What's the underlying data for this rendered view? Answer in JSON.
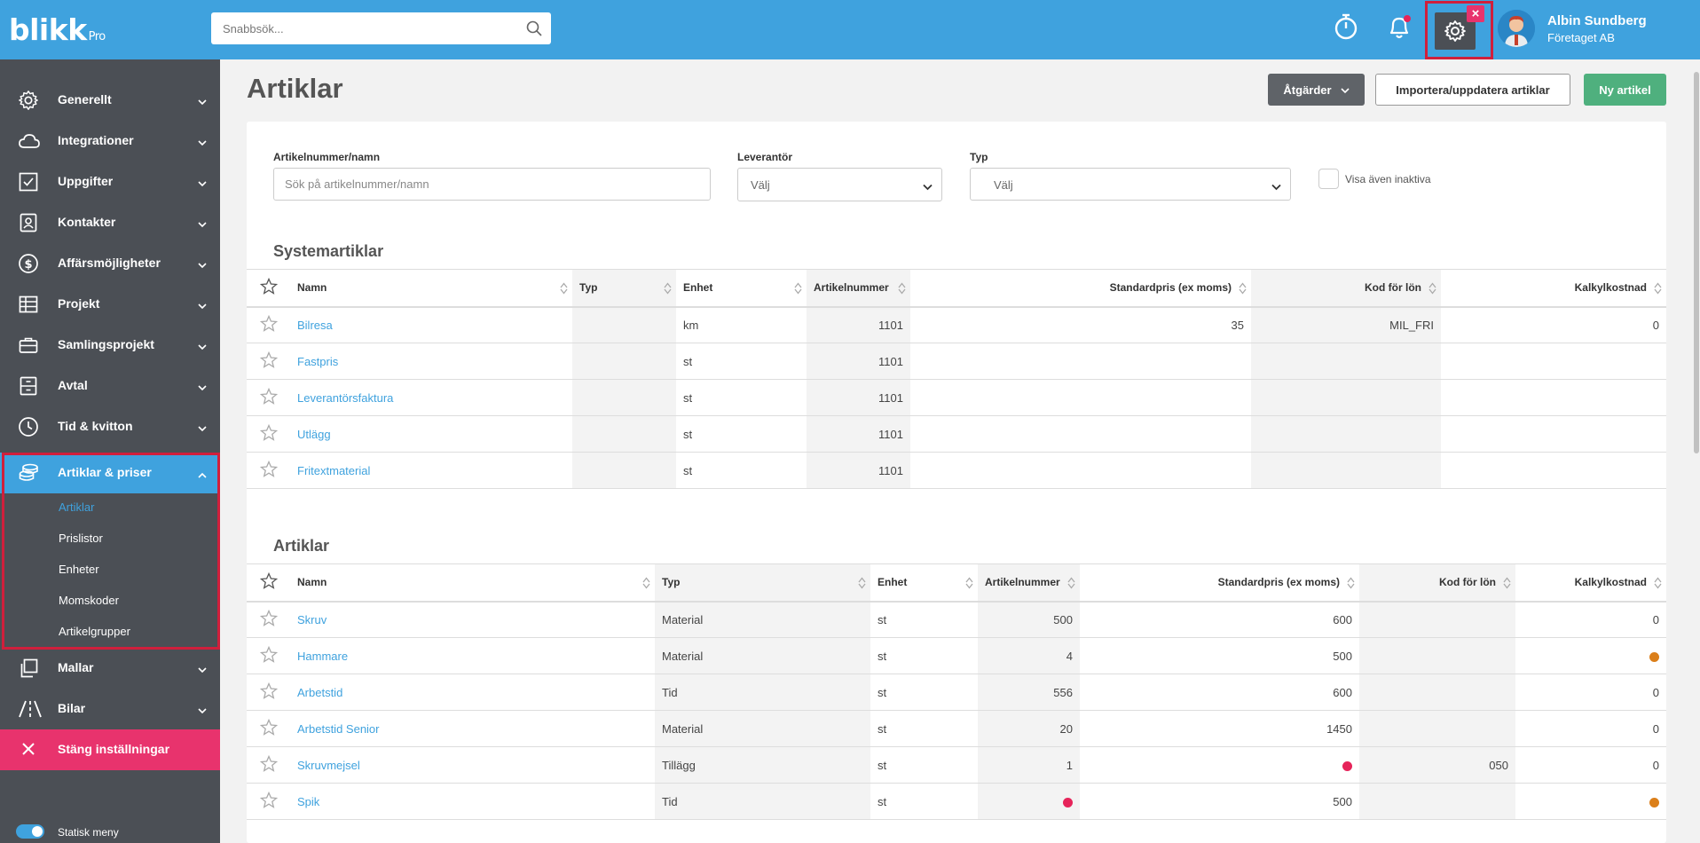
{
  "header": {
    "logo_text": "blikk",
    "logo_suffix": "Pro",
    "search_placeholder": "Snabbsök...",
    "user_name": "Albin Sundberg",
    "user_company": "Företaget AB",
    "notification_dot_color": "#e6245a",
    "icons": [
      "timer-icon",
      "bell-icon",
      "gear-icon",
      "close-icon",
      "search-icon"
    ]
  },
  "sidebar": {
    "items": [
      {
        "label": "Generellt",
        "icon": "gear-icon"
      },
      {
        "label": "Integrationer",
        "icon": "cloud-icon"
      },
      {
        "label": "Uppgifter",
        "icon": "checkbox-icon"
      },
      {
        "label": "Kontakter",
        "icon": "contact-icon"
      },
      {
        "label": "Affärsmöjligheter",
        "icon": "dollar-icon"
      },
      {
        "label": "Projekt",
        "icon": "table-icon"
      },
      {
        "label": "Samlingsprojekt",
        "icon": "briefcase-icon"
      },
      {
        "label": "Avtal",
        "icon": "cabinet-icon"
      },
      {
        "label": "Tid & kvitton",
        "icon": "clock-icon"
      },
      {
        "label": "Artiklar & priser",
        "icon": "coins-icon"
      },
      {
        "label": "Mallar",
        "icon": "copy-icon"
      },
      {
        "label": "Bilar",
        "icon": "road-icon"
      }
    ],
    "subitems": [
      "Artiklar",
      "Prislistor",
      "Enheter",
      "Momskoder",
      "Artikelgrupper"
    ],
    "close_label": "Stäng inställningar",
    "toggle_label": "Statisk meny"
  },
  "main": {
    "title": "Artiklar",
    "buttons": {
      "actions": "Åtgärder",
      "import": "Importera/uppdatera artiklar",
      "new": "Ny artikel"
    },
    "filters": {
      "article_label": "Artikelnummer/namn",
      "article_placeholder": "Sök på artikelnummer/namn",
      "supplier_label": "Leverantör",
      "supplier_value": "Välj",
      "type_label": "Typ",
      "type_value": "Välj",
      "inactive_label": "Visa även inaktiva"
    },
    "system_articles": {
      "title": "Systemartiklar",
      "columns": [
        "Namn",
        "Typ",
        "Enhet",
        "Artikelnummer",
        "Standardpris (ex moms)",
        "Kod för lön",
        "Kalkylkostnad"
      ],
      "rows": [
        {
          "name": "Bilresa",
          "type": "",
          "unit": "km",
          "number": "1101",
          "price": "35",
          "code": "MIL_FRI",
          "cost": "0"
        },
        {
          "name": "Fastpris",
          "type": "",
          "unit": "st",
          "number": "1101",
          "price": "",
          "code": "",
          "cost": ""
        },
        {
          "name": "Leverantörsfaktura",
          "type": "",
          "unit": "st",
          "number": "1101",
          "price": "",
          "code": "",
          "cost": ""
        },
        {
          "name": "Utlägg",
          "type": "",
          "unit": "st",
          "number": "1101",
          "price": "",
          "code": "",
          "cost": ""
        },
        {
          "name": "Fritextmaterial",
          "type": "",
          "unit": "st",
          "number": "1101",
          "price": "",
          "code": "",
          "cost": ""
        }
      ]
    },
    "articles": {
      "title": "Artiklar",
      "columns": [
        "Namn",
        "Typ",
        "Enhet",
        "Artikelnummer",
        "Standardpris (ex moms)",
        "Kod för lön",
        "Kalkylkostnad"
      ],
      "rows": [
        {
          "name": "Skruv",
          "type": "Material",
          "unit": "st",
          "number": "500",
          "price": "600",
          "code": "",
          "cost": "0"
        },
        {
          "name": "Hammare",
          "type": "Material",
          "unit": "st",
          "number": "4",
          "price": "500",
          "code": "",
          "cost": "",
          "cost_dot": "#db7f1a"
        },
        {
          "name": "Arbetstid",
          "type": "Tid",
          "unit": "st",
          "number": "556",
          "price": "600",
          "code": "",
          "cost": "0"
        },
        {
          "name": "Arbetstid Senior",
          "type": "Material",
          "unit": "st",
          "number": "20",
          "price": "1450",
          "code": "",
          "cost": "0"
        },
        {
          "name": "Skruvmejsel",
          "type": "Tillägg",
          "unit": "st",
          "number": "1",
          "price": "",
          "price_dot": "#e6245a",
          "code": "050",
          "cost": "0"
        },
        {
          "name": "Spik",
          "type": "Tid",
          "unit": "st",
          "number": "",
          "number_dot": "#e6245a",
          "price": "500",
          "code": "",
          "cost": "",
          "cost_dot": "#db7f1a"
        }
      ]
    }
  }
}
